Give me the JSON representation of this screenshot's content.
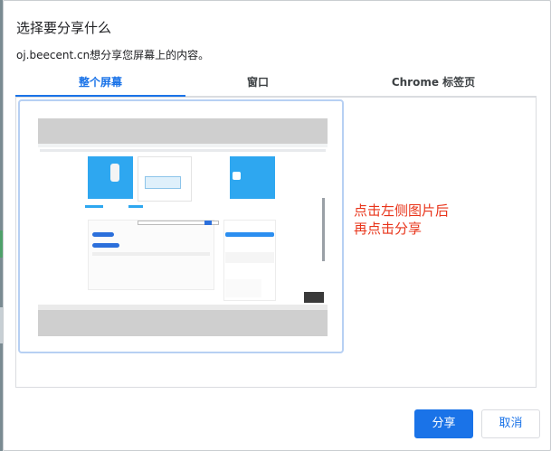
{
  "dialog": {
    "title": "选择要分享什么",
    "subtitle": "oj.beecent.cn想分享您屏幕上的内容。"
  },
  "tabs": [
    {
      "label": "整个屏幕",
      "active": true
    },
    {
      "label": "窗口",
      "active": false
    },
    {
      "label": "Chrome 标签页",
      "active": false
    }
  ],
  "instruction": {
    "line1": "点击左侧图片后",
    "line2": "再点击分享",
    "color": "#e8341a"
  },
  "buttons": {
    "share_label": "分享",
    "cancel_label": "取消"
  },
  "colors": {
    "accent": "#1a73e8"
  }
}
